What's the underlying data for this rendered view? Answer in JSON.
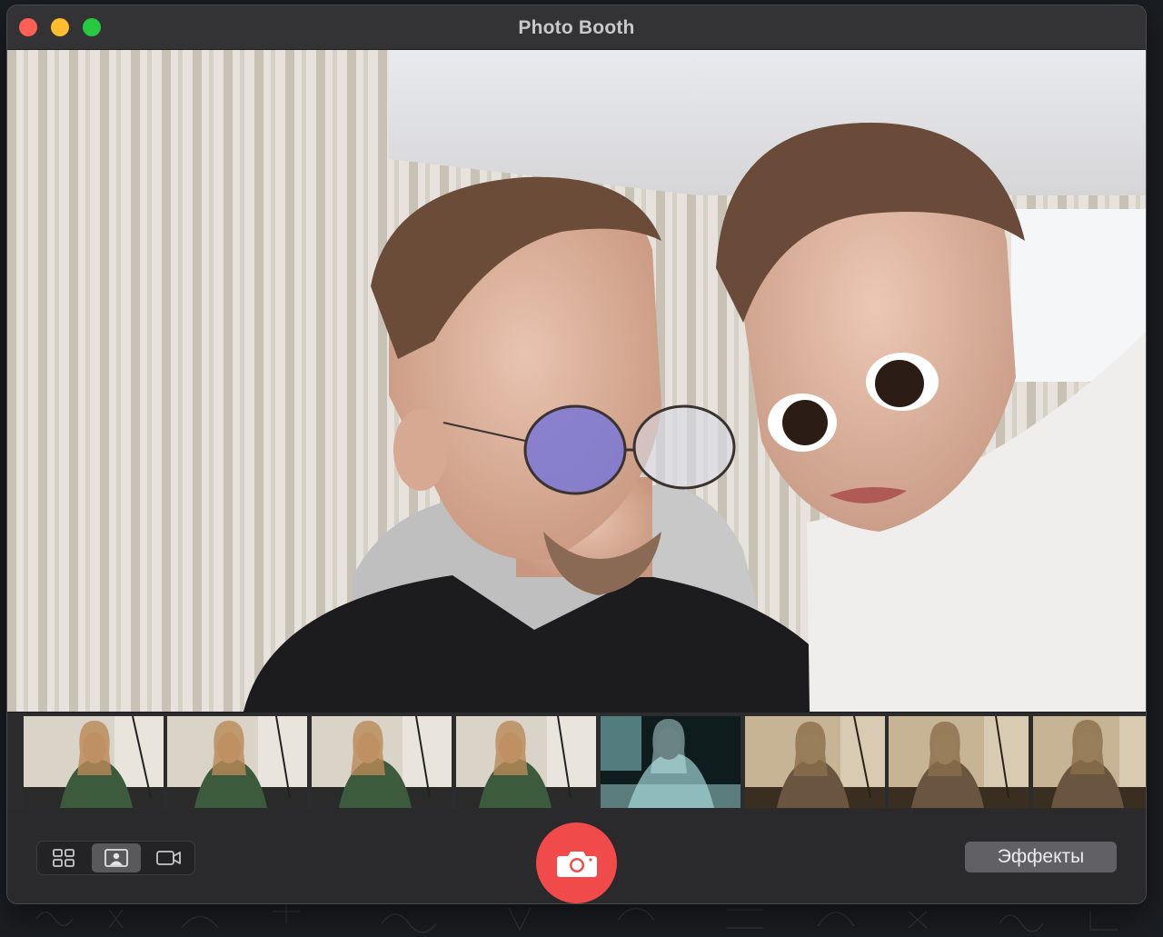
{
  "window": {
    "title": "Photo Booth"
  },
  "traffic_lights": {
    "close": "#fe5f57",
    "minimize": "#febc2e",
    "maximize": "#28c840"
  },
  "camera_view": {
    "content": "live-camera-feed-with-face-distortion-effect"
  },
  "filmstrip": {
    "thumbnails": [
      {
        "filter": "normal"
      },
      {
        "filter": "normal"
      },
      {
        "filter": "normal"
      },
      {
        "filter": "normal"
      },
      {
        "filter": "cyan-negative"
      },
      {
        "filter": "sepia"
      },
      {
        "filter": "sepia"
      },
      {
        "filter": "sepia"
      }
    ]
  },
  "toolbar": {
    "view_modes": [
      {
        "icon": "grid-four-icon",
        "selected": false
      },
      {
        "icon": "single-photo-icon",
        "selected": true
      },
      {
        "icon": "video-camera-icon",
        "selected": false
      }
    ],
    "shutter_icon": "camera-icon",
    "shutter_color": "#f04a4a",
    "effects_label": "Эффекты"
  }
}
